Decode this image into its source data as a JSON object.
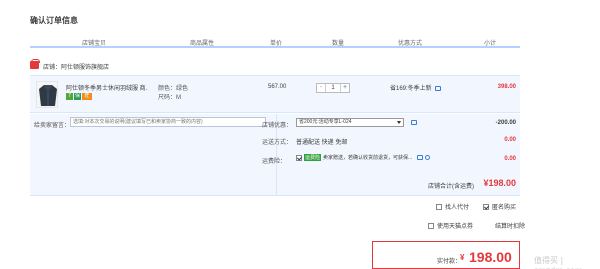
{
  "page": {
    "title": "确认订单信息"
  },
  "columns": [
    "店铺宝贝",
    "商品属性",
    "单价",
    "数量",
    "优惠方式",
    "小计"
  ],
  "shop": {
    "label": "店铺：阿仕顿服饰旗舰店"
  },
  "item": {
    "title": "阿仕顿冬季男士休闲羽绒服 商...",
    "badges": [
      "7",
      "保",
      "旺"
    ],
    "color": "颜色：绿色",
    "size": "尺码：M",
    "unit_price": "567.00",
    "qty_minus": "-",
    "quantity": "1",
    "qty_plus": "+",
    "promo": "省169:冬季上新",
    "subtotal": "398.00"
  },
  "message": {
    "label": "给卖家留言：",
    "placeholder": "选填:对本次交易的说明(建议填写已和卖家协商一致的内容)"
  },
  "shop_discount": {
    "label": "店铺优惠：",
    "selected": "省200元:活动专享L-024",
    "value": "-200.00"
  },
  "shipping": {
    "label": "运送方式：",
    "value": "普通配送 快递 免邮",
    "amount": "0.00"
  },
  "insurance": {
    "label": "运费险：",
    "tag": "运费险",
    "text": "卖家赠送，若确认收货前退货，可获保...",
    "amount": "0.00"
  },
  "shop_total": {
    "label": "店铺合计(含运费)",
    "value": "¥198.00"
  },
  "options": {
    "proxy_pay": "找人代付",
    "anonymous": "匿名购买",
    "use_points": "使用天猫点券",
    "invoice": "结算时扣除"
  },
  "payment": {
    "label": "实付款：",
    "symbol": "¥",
    "amount": "198.00"
  },
  "watermark": "值得买 | smzdm.com",
  "colors": {
    "accent_red": "#e4393c",
    "header_line": "#b2d1ff",
    "panel_bg": "#f2f7ff"
  }
}
